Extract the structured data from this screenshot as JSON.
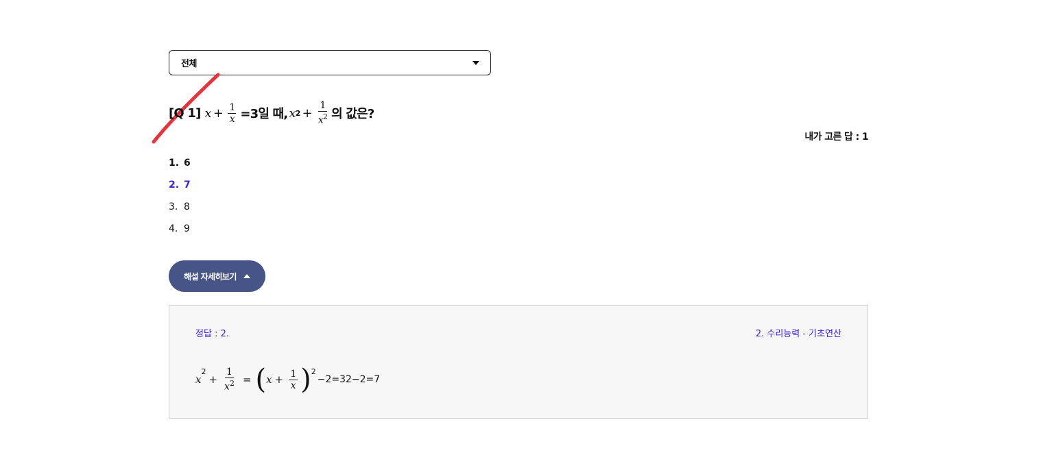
{
  "filter": {
    "selected": "전체"
  },
  "question": {
    "prefix": "[Q 1]",
    "x": "x",
    "plus": "+",
    "one": "1",
    "eq_text": "=3일 때,",
    "sq": "2",
    "suffix": "의 값은?"
  },
  "my_answer": "내가 고른 답 : 1",
  "options": [
    {
      "num": "1.",
      "text": "6",
      "state": "chosen"
    },
    {
      "num": "2.",
      "text": "7",
      "state": "correct"
    },
    {
      "num": "3.",
      "text": "8",
      "state": "normal"
    },
    {
      "num": "4.",
      "text": "9",
      "state": "normal"
    }
  ],
  "toggle": {
    "label": "해설 자세히보기"
  },
  "explanation": {
    "answer_label": "정답 : 2.",
    "category": "2. 수리능력 - 기초연산",
    "eq": "=",
    "open": "(",
    "close": ")",
    "tail": "−2=32−2=7"
  },
  "colors": {
    "accent": "#3b1ee8",
    "button": "#465486",
    "slash": "#e8323c"
  }
}
